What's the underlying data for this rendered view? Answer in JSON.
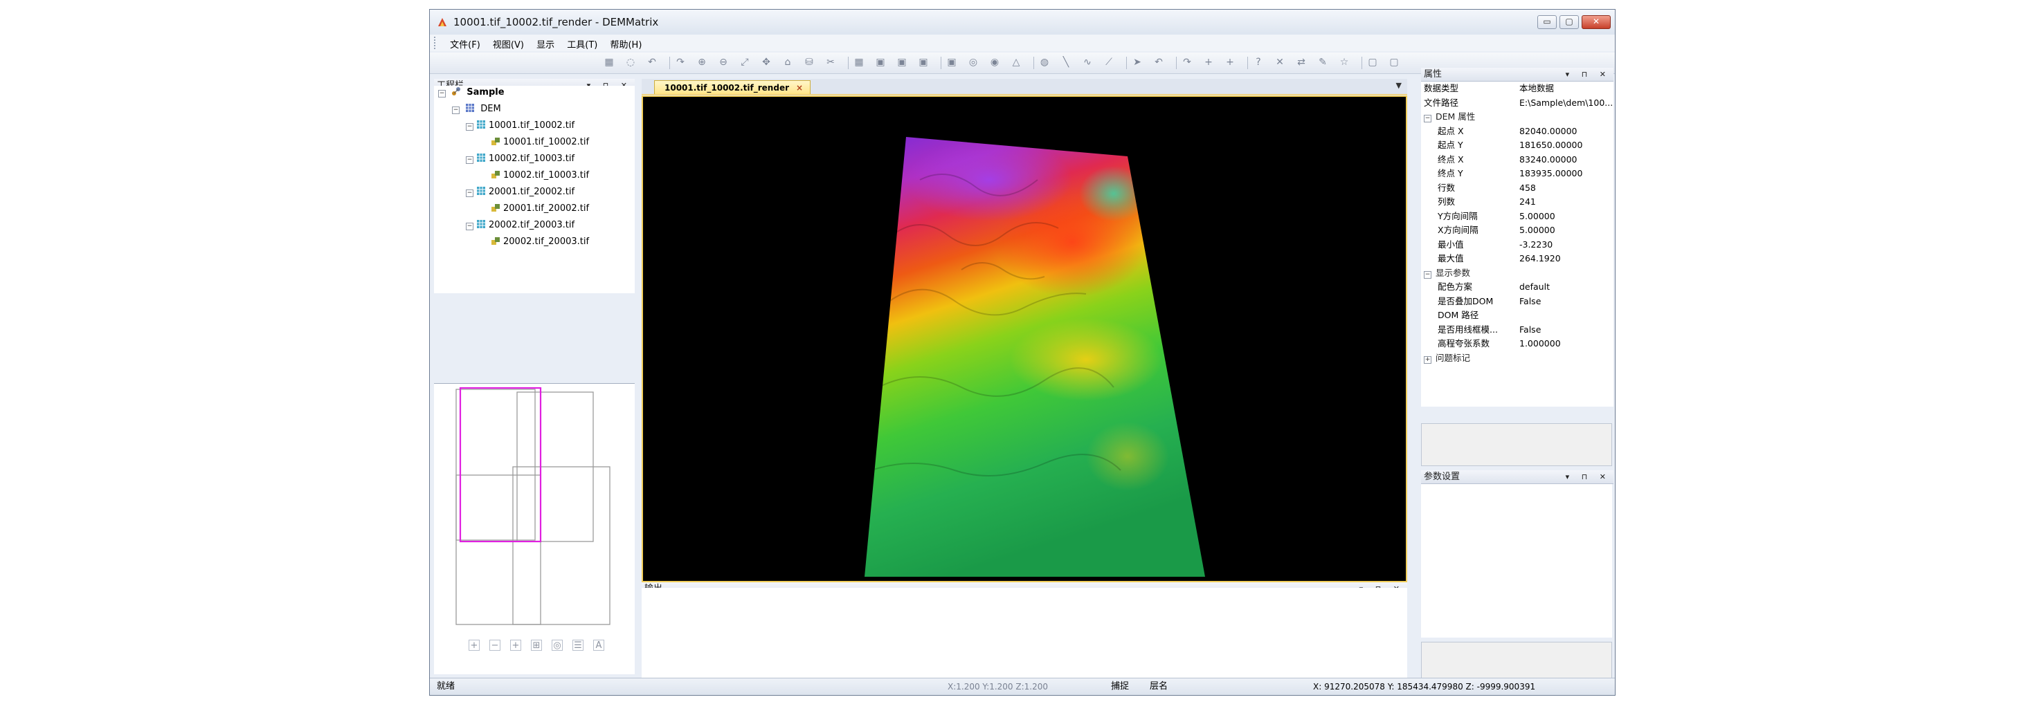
{
  "window": {
    "title": "10001.tif_10002.tif_render - DEMMatrix",
    "controls": {
      "minimize": "▭",
      "maximize": "▢",
      "close": "✕"
    }
  },
  "menu": [
    "文件(F)",
    "视图(V)",
    "显示",
    "工具(T)",
    "帮助(H)"
  ],
  "toolbar_icons": [
    "new-icon",
    "open-icon",
    "undo-icon",
    "redo-icon",
    "zoom-in-icon",
    "zoom-out-icon",
    "zoom-extent-icon",
    "pan-icon",
    "home-icon",
    "layer-icon",
    "cut-icon",
    "grid-icon",
    "window-icon",
    "window2-icon",
    "window3-icon",
    "window4-icon",
    "target-icon",
    "globe-icon",
    "triangle-icon",
    "camera-icon",
    "line-icon",
    "curve-icon",
    "polyline-icon",
    "pointer-icon",
    "undo2-icon",
    "redo2-icon",
    "add-point-icon",
    "add-line-icon",
    "help-icon",
    "delete-icon",
    "swap-icon",
    "edit-icon",
    "star-icon",
    "frame-icon",
    "frame2-icon"
  ],
  "project_panel": {
    "title": "工程栏",
    "root": "Sample",
    "dem": "DEM",
    "items": [
      {
        "parent": "10001.tif_10002.tif",
        "child": "10001.tif_10002.tif"
      },
      {
        "parent": "10002.tif_10003.tif",
        "child": "10002.tif_10003.tif"
      },
      {
        "parent": "20001.tif_20002.tif",
        "child": "20001.tif_20002.tif"
      },
      {
        "parent": "20002.tif_20003.tif",
        "child": "20002.tif_20003.tif"
      }
    ]
  },
  "document_tab": {
    "label": "10001.tif_10002.tif_render",
    "close": "×"
  },
  "output_panel": {
    "title": "输出"
  },
  "properties_panel": {
    "title": "属性",
    "top_rows": [
      {
        "key": "数据类型",
        "value": "本地数据"
      },
      {
        "key": "文件路径",
        "value": "E:\\Sample\\dem\\100..."
      }
    ],
    "dem_category": "DEM 属性",
    "dem_rows": [
      {
        "key": "起点 X",
        "value": "82040.00000"
      },
      {
        "key": "起点 Y",
        "value": "181650.00000"
      },
      {
        "key": "终点 X",
        "value": "83240.00000"
      },
      {
        "key": "终点 Y",
        "value": "183935.00000"
      },
      {
        "key": "行数",
        "value": "458"
      },
      {
        "key": "列数",
        "value": "241"
      },
      {
        "key": "Y方向间隔",
        "value": "5.00000"
      },
      {
        "key": "X方向间隔",
        "value": "5.00000"
      },
      {
        "key": "最小值",
        "value": "-3.2230"
      },
      {
        "key": "最大值",
        "value": "264.1920"
      }
    ],
    "display_category": "显示参数",
    "display_rows": [
      {
        "key": "配色方案",
        "value": "default"
      },
      {
        "key": "是否叠加DOM",
        "value": "False"
      },
      {
        "key": "DOM 路径",
        "value": ""
      },
      {
        "key": "是否用线框模...",
        "value": "False"
      },
      {
        "key": "高程夸张系数",
        "value": "1.000000"
      }
    ],
    "issue_category": "问题标记"
  },
  "params_panel": {
    "title": "参数设置"
  },
  "panel_buttons": "▾ ⊓ ✕",
  "overview_tools": [
    "+",
    "−",
    "+",
    "⊞",
    "◎",
    "☰",
    "A"
  ],
  "statusbar": {
    "ready": "就绪",
    "xyz_small": "X:1.200 Y:1.200 Z:1.200",
    "snap": "捕捉",
    "layer": "层名",
    "coords": "X: 91270.205078 Y: 185434.479980 Z: -9999.900391"
  },
  "colors": {
    "accent_tab": "#ffe58a",
    "viewport_bg": "#000000",
    "selection": "#e020e0"
  }
}
